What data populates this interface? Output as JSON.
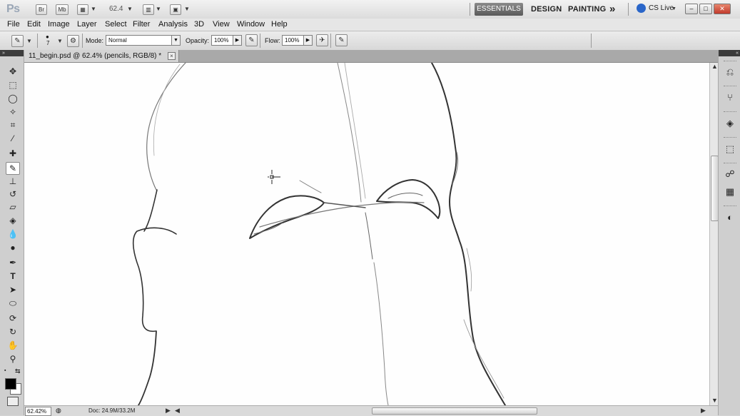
{
  "app": {
    "logo": "Ps",
    "bridge_label": "Br",
    "mini_bridge_label": "Mb",
    "zoom_level": "62.4"
  },
  "workspaces": {
    "essentials": "ESSENTIALS",
    "design": "DESIGN",
    "painting": "PAINTING",
    "more": "»"
  },
  "cs_live": "CS Live",
  "menu": [
    "File",
    "Edit",
    "Image",
    "Layer",
    "Select",
    "Filter",
    "Analysis",
    "3D",
    "View",
    "Window",
    "Help"
  ],
  "options": {
    "brush_size": "7",
    "mode_label": "Mode:",
    "mode_value": "Normal",
    "opacity_label": "Opacity:",
    "opacity_value": "100%",
    "flow_label": "Flow:",
    "flow_value": "100%"
  },
  "document": {
    "tab_title": "11_begin.psd @ 62.4% (pencils, RGB/8) *",
    "close": "×"
  },
  "status": {
    "zoom": "62.42%",
    "doc_info": "Doc: 24.9M/33.2M"
  },
  "colors": {
    "foreground": "#000000",
    "background": "#ffffff",
    "workspace_active": "#6a6a6a"
  },
  "tools": [
    "move-tool",
    "marquee-tool",
    "lasso-tool",
    "quick-selection-tool",
    "crop-tool",
    "eyedropper-tool",
    "healing-brush-tool",
    "brush-tool",
    "clone-stamp-tool",
    "history-brush-tool",
    "eraser-tool",
    "paint-bucket-tool",
    "blur-tool",
    "dodge-tool",
    "pen-tool",
    "type-tool",
    "path-selection-tool",
    "shape-tool",
    "3d-rotate-tool",
    "3d-orbit-tool",
    "hand-tool",
    "zoom-tool"
  ],
  "right_panel_icons": [
    "history-icon",
    "brushes-icon",
    "layers-icon",
    "transform-icon",
    "channels-icon",
    "swatches-icon",
    "adjustments-icon"
  ]
}
